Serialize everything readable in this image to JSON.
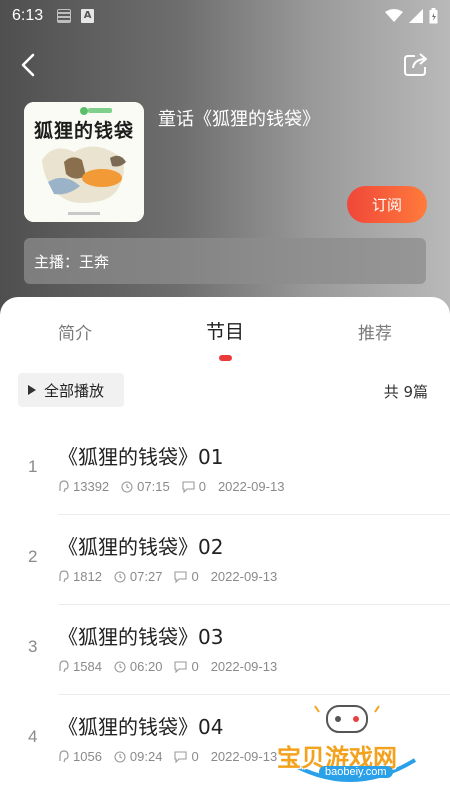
{
  "status_bar": {
    "time": "6:13",
    "notif_icon_a": "A"
  },
  "header": {
    "album_title": "童话《狐狸的钱袋》",
    "subscribe_label": "订阅",
    "host_label": "主播：王奔",
    "cover_title_text": "狐狸的钱袋"
  },
  "tabs": [
    {
      "label": "简介",
      "active": false
    },
    {
      "label": "节目",
      "active": true
    },
    {
      "label": "推荐",
      "active": false
    }
  ],
  "playlist": {
    "play_all_label": "全部播放",
    "total_label": "共 9篇"
  },
  "episodes": [
    {
      "num": "1",
      "title": "《狐狸的钱袋》01",
      "plays": "13392",
      "duration": "07:15",
      "comments": "0",
      "date": "2022-09-13"
    },
    {
      "num": "2",
      "title": "《狐狸的钱袋》02",
      "plays": "1812",
      "duration": "07:27",
      "comments": "0",
      "date": "2022-09-13"
    },
    {
      "num": "3",
      "title": "《狐狸的钱袋》03",
      "plays": "1584",
      "duration": "06:20",
      "comments": "0",
      "date": "2022-09-13"
    },
    {
      "num": "4",
      "title": "《狐狸的钱袋》04",
      "plays": "1056",
      "duration": "09:24",
      "comments": "0",
      "date": "2022-09-13"
    }
  ],
  "watermark": {
    "text": "宝贝游戏网",
    "url": "baobeiy.com"
  },
  "colors": {
    "accent": "#ea3a3a",
    "subscribe_start": "#f0463a",
    "subscribe_end": "#ff7b3b"
  }
}
